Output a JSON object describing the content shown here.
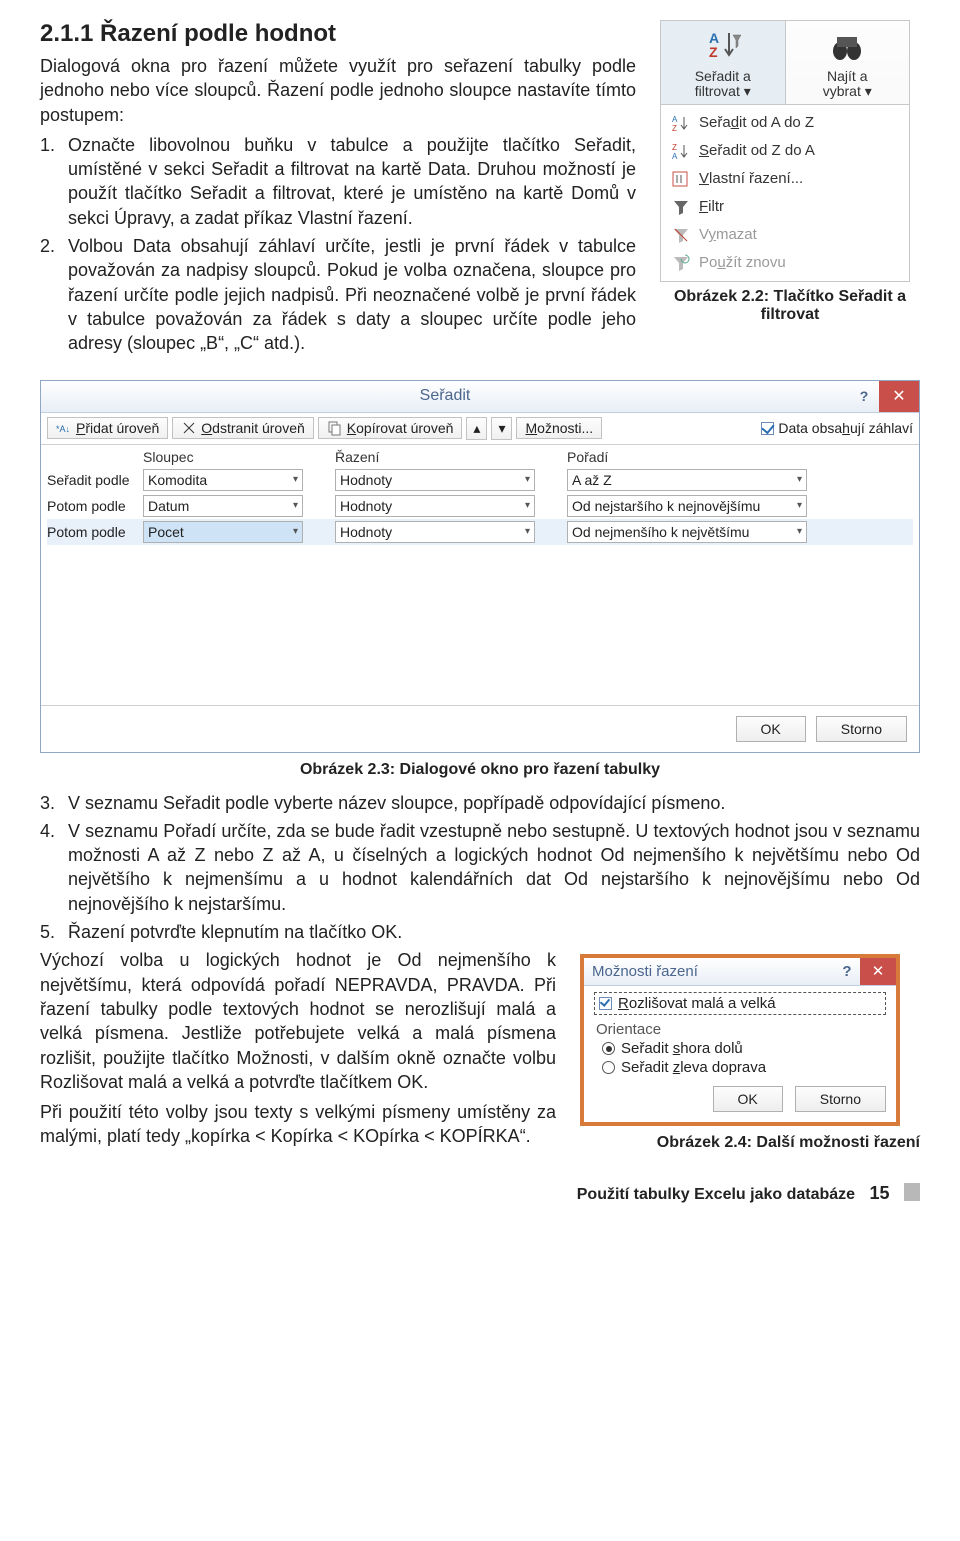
{
  "section": {
    "heading": "2.1.1  Řazení podle hodnot",
    "intro": "Dialogová okna pro řazení můžete využít pro seřazení tabulky podle jednoho nebo více sloupců. Řazení podle jednoho sloupce nastavíte tímto postupem:",
    "step1": "Označte libovolnou buňku v tabulce a použijte tlačítko Seřadit, umístěné v sekci Seřadit a filtrovat na kartě Data. Druhou možností je použít tlačítko Seřadit a filtrovat, které je umístěno na kartě Domů v sekci Úpravy, a zadat příkaz Vlastní řazení.",
    "step2": "Volbou Data obsahují záhlaví určíte, jestli je první řádek v tabulce považován za nadpisy sloupců. Pokud je volba označena, sloupce pro řazení určíte podle jejich nadpisů. Při neoznačené volbě je první řádek v tabulce považován za řádek s daty a sloupec určíte podle jeho adresy (sloupec „B“, „C“ atd.).",
    "step3": "V seznamu Seřadit podle vyberte název sloupce, popřípadě odpovídající písmeno.",
    "step4": "V seznamu Pořadí určíte, zda se bude řadit vzestupně nebo sestupně. U textových hodnot jsou v seznamu možnosti A až Z nebo Z až A, u číselných a logických hodnot Od nejmenšího k největšímu nebo Od největšího k nejmenšímu a u hodnot kalendářních dat Od nejstaršího k nejnovějšímu nebo Od nejnovějšího k nejstaršímu.",
    "step5": "Řazení potvrďte klepnutím na tlačítko OK.",
    "para_after": "Výchozí volba u logických hodnot je Od nejmenšího k největšímu, která odpovídá pořadí NEPRAVDA, PRAVDA. Při řazení tabulky podle textových hodnot se nerozlišují malá a velká písmena. Jestliže potřebujete velká a malá písmena rozlišit, použijte tlačítko Možnosti, v dalším okně označte volbu Rozlišovat malá a velká a potvrďte tlačítkem OK.",
    "para_after2": "Při použití této volby jsou texty s velkými písmeny umístěny za malými, platí tedy „kopírka < Kopírka < KOpírka < KOPÍRKA“."
  },
  "ribbon": {
    "group1": {
      "line1": "Seřadit a",
      "line2": "filtrovat ▾"
    },
    "group2": {
      "line1": "Najít a",
      "line2": "vybrat ▾"
    },
    "items": [
      {
        "label": "Seřadit od A do Z"
      },
      {
        "label": "Seřadit od Z do A"
      },
      {
        "label": "Vlastní řazení..."
      },
      {
        "label": "Filtr"
      },
      {
        "label": "Vymazat",
        "disabled": true
      },
      {
        "label": "Použít znovu",
        "disabled": true
      }
    ]
  },
  "caption22": "Obrázek 2.2: Tlačítko Seřadit a filtrovat",
  "sort_dialog": {
    "title": "Seřadit",
    "toolbar": {
      "add": "Přidat úroveň",
      "remove": "Odstranit úroveň",
      "copy": "Kopírovat úroveň",
      "options": "Možnosti...",
      "header_checkbox": "Data obsahují záhlaví"
    },
    "columns": {
      "c1": "Sloupec",
      "c2": "Řazení",
      "c3": "Pořadí"
    },
    "rows": [
      {
        "label": "Seřadit podle",
        "col": "Komodita",
        "by": "Hodnoty",
        "order": "A až Z"
      },
      {
        "label": "Potom podle",
        "col": "Datum",
        "by": "Hodnoty",
        "order": "Od nejstaršího k nejnovějšímu"
      },
      {
        "label": "Potom podle",
        "col": "Pocet",
        "by": "Hodnoty",
        "order": "Od nejmenšího k největšímu",
        "selected": true
      }
    ],
    "ok": "OK",
    "cancel": "Storno"
  },
  "caption23": "Obrázek 2.3: Dialogové okno pro řazení tabulky",
  "opt_dialog": {
    "title": "Možnosti řazení",
    "check": "Rozlišovat malá a velká",
    "group": "Orientace",
    "r1": "Seřadit shora dolů",
    "r2": "Seřadit zleva doprava",
    "ok": "OK",
    "cancel": "Storno"
  },
  "caption24": "Obrázek 2.4: Další možnosti řazení",
  "footer": {
    "text": "Použití tabulky Excelu jako databáze",
    "page": "15"
  }
}
